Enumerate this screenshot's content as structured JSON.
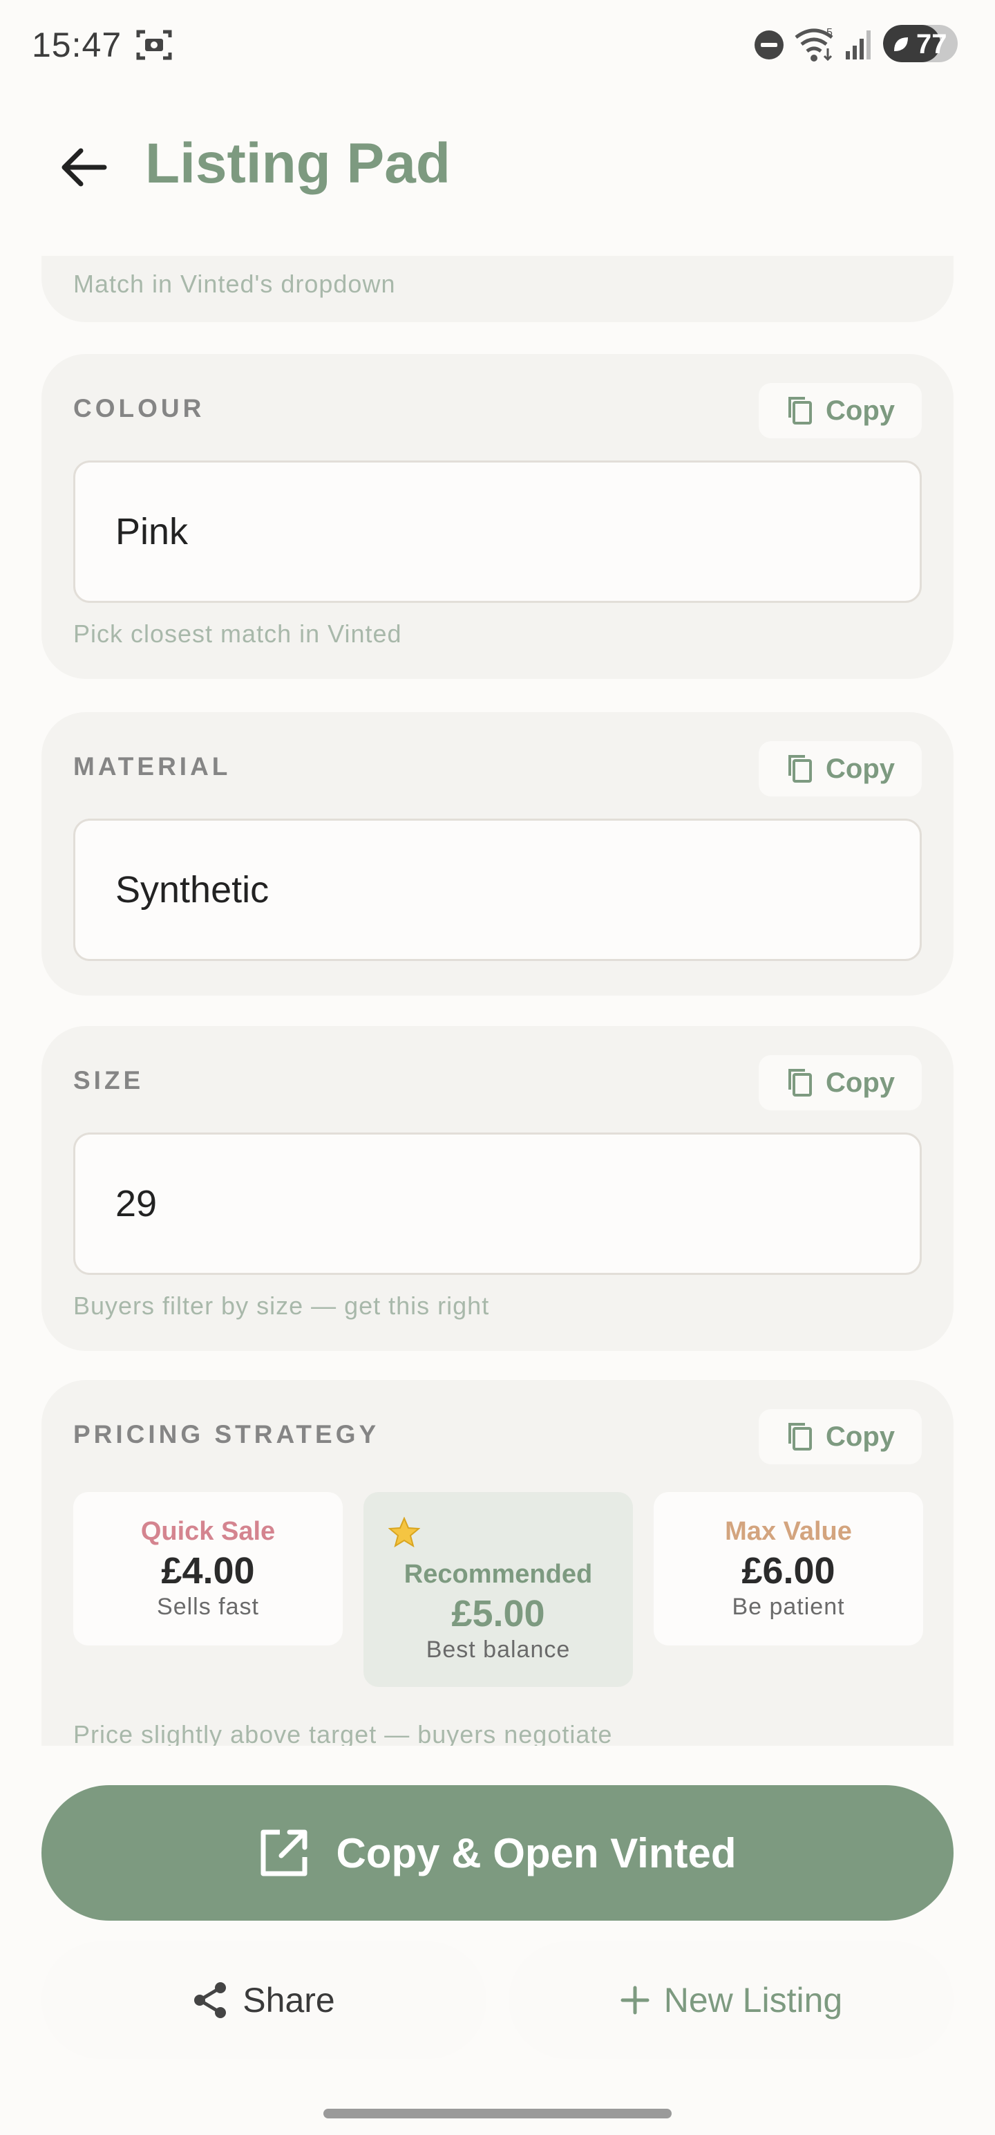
{
  "status_bar": {
    "time": "15:47",
    "battery": "77",
    "signal_label": "5"
  },
  "header": {
    "title": "Listing Pad"
  },
  "fields": {
    "prev_hint": "Match in Vinted's dropdown",
    "colour": {
      "label": "COLOUR",
      "value": "Pink",
      "hint": "Pick closest match in Vinted",
      "copy_label": "Copy"
    },
    "material": {
      "label": "MATERIAL",
      "value": "Synthetic",
      "copy_label": "Copy"
    },
    "size": {
      "label": "SIZE",
      "value": "29",
      "hint": "Buyers filter by size — get this right",
      "copy_label": "Copy"
    }
  },
  "pricing": {
    "label": "PRICING STRATEGY",
    "copy_label": "Copy",
    "options": [
      {
        "name": "Quick Sale",
        "price": "£4.00",
        "sub": "Sells fast",
        "color": "#d4848f"
      },
      {
        "name": "Recommended",
        "price": "£5.00",
        "sub": "Best balance",
        "color": "#7d9a80",
        "icon": "star-icon"
      },
      {
        "name": "Max Value",
        "price": "£6.00",
        "sub": "Be patient",
        "color": "#d3a47e"
      }
    ],
    "hint": "Price slightly above target — buyers negotiate"
  },
  "actions": {
    "primary": "Copy & Open Vinted",
    "share": "Share",
    "new_listing": "New Listing"
  },
  "colors": {
    "accent": "#7d9a80",
    "background": "#fcfbf9",
    "card": "#f4f3f0"
  }
}
